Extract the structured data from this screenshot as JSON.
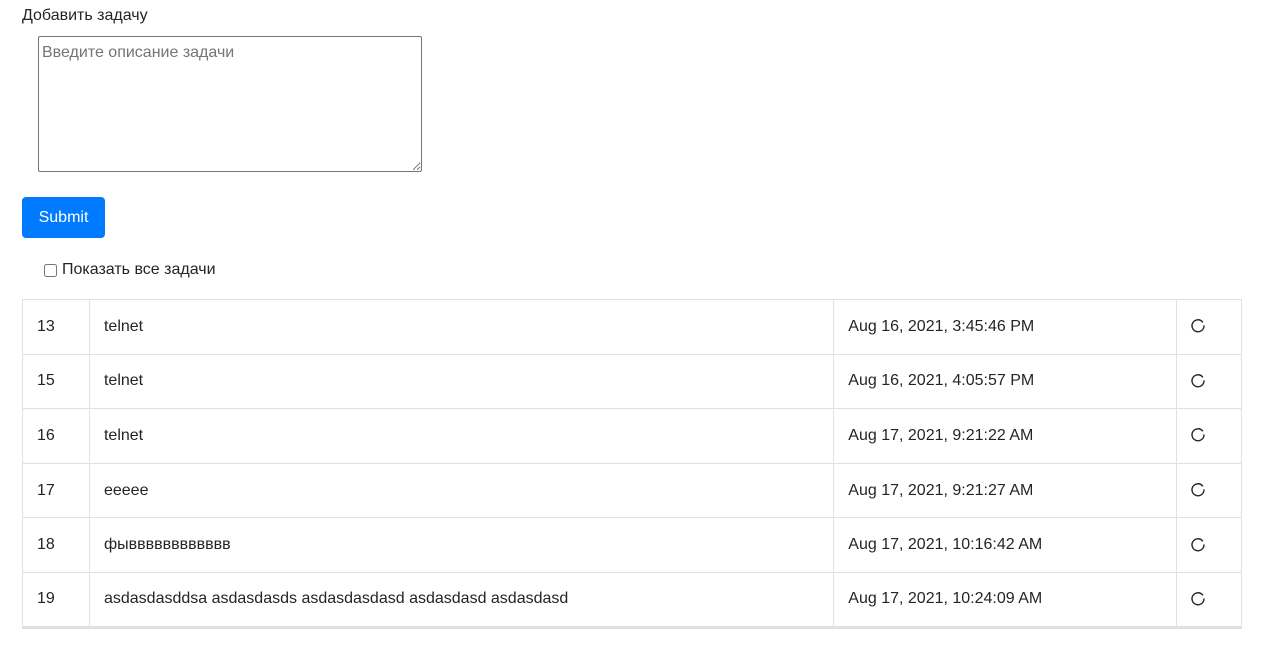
{
  "form": {
    "label": "Добавить задачу",
    "textarea_placeholder": "Введите описание задачи",
    "textarea_value": "",
    "submit_label": "Submit"
  },
  "filter": {
    "show_all_label": "Показать все задачи",
    "show_all_checked": false
  },
  "tasks": [
    {
      "id": "13",
      "description": "telnet",
      "date": "Aug 16, 2021, 3:45:46 PM",
      "action_icon": "refresh-icon"
    },
    {
      "id": "15",
      "description": "telnet",
      "date": "Aug 16, 2021, 4:05:57 PM",
      "action_icon": "refresh-icon"
    },
    {
      "id": "16",
      "description": "telnet",
      "date": "Aug 17, 2021, 9:21:22 AM",
      "action_icon": "refresh-icon"
    },
    {
      "id": "17",
      "description": "eeeee",
      "date": "Aug 17, 2021, 9:21:27 AM",
      "action_icon": "refresh-icon"
    },
    {
      "id": "18",
      "description": "фывввввввввввв",
      "date": "Aug 17, 2021, 10:16:42 AM",
      "action_icon": "refresh-icon"
    },
    {
      "id": "19",
      "description": "asdasdasddsa asdasdasds asdasdasdasd asdasdasd asdasdasd",
      "date": "Aug 17, 2021, 10:24:09 AM",
      "action_icon": "refresh-icon"
    }
  ],
  "colors": {
    "primary": "#007bff",
    "table_border": "#dee2e6",
    "text": "#212529"
  }
}
